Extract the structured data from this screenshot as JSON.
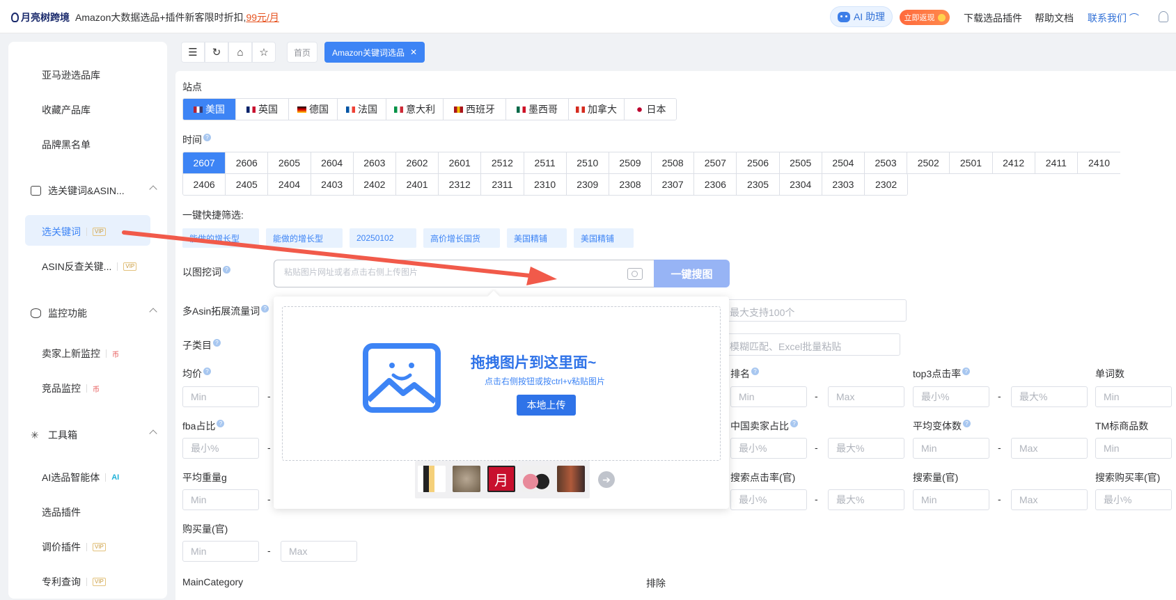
{
  "header": {
    "logo_text": "月亮树跨境",
    "promo_text": "Amazon大数据选品+插件新客限时折扣,",
    "promo_price": "99元/月",
    "ai_assistant": "AI 助理",
    "rebate": "立即返现",
    "nav": [
      "下载选品插件",
      "帮助文档",
      "联系我们"
    ]
  },
  "sidebar": {
    "items_top": [
      "亚马逊选品库",
      "收藏产品库",
      "品牌黑名单"
    ],
    "group_keywords": "选关键词&ASIN...",
    "keyword_items": [
      "选关键词",
      "ASIN反查关键..."
    ],
    "group_monitor": "监控功能",
    "monitor_items": [
      "卖家上新监控",
      "竞品监控"
    ],
    "group_tools": "工具箱",
    "tool_items": [
      "AI选品智能体",
      "选品插件",
      "调价插件",
      "专利查询"
    ],
    "vip": "VIP",
    "coin": "币",
    "ai": "AI"
  },
  "tabs": {
    "home": "首页",
    "active": "Amazon关键词选品"
  },
  "filters": {
    "site_label": "站点",
    "sites": [
      {
        "name": "美国",
        "colors": [
          "#b22234",
          "#fff",
          "#3c3b6e"
        ]
      },
      {
        "name": "英国",
        "colors": [
          "#012169",
          "#fff",
          "#c8102e"
        ]
      },
      {
        "name": "德国",
        "colors": [
          "#000",
          "#dd0000",
          "#ffce00"
        ]
      },
      {
        "name": "法国",
        "colors": [
          "#0055a4",
          "#fff",
          "#ef4135"
        ]
      },
      {
        "name": "意大利",
        "colors": [
          "#009246",
          "#fff",
          "#ce2b37"
        ]
      },
      {
        "name": "西班牙",
        "colors": [
          "#aa151b",
          "#f1bf00",
          "#aa151b"
        ]
      },
      {
        "name": "墨西哥",
        "colors": [
          "#006847",
          "#fff",
          "#ce1126"
        ]
      },
      {
        "name": "加拿大",
        "colors": [
          "#d52b1e",
          "#fff",
          "#d52b1e"
        ]
      },
      {
        "name": "日本",
        "colors": [
          "#fff",
          "#bc002d",
          "#fff"
        ]
      }
    ],
    "time_label": "时间",
    "time_row1": [
      "2607",
      "2606",
      "2605",
      "2604",
      "2603",
      "2602",
      "2601",
      "2512",
      "2511",
      "2510",
      "2509",
      "2508",
      "2507",
      "2506",
      "2505",
      "2504",
      "2503",
      "2502",
      "2501",
      "2412",
      "2411",
      "2410"
    ],
    "time_row2": [
      "2406",
      "2405",
      "2404",
      "2403",
      "2402",
      "2401",
      "2312",
      "2311",
      "2310",
      "2309",
      "2308",
      "2307",
      "2306",
      "2305",
      "2304",
      "2303",
      "2302"
    ],
    "quick_label": "一键快捷筛选:",
    "quick": [
      "能做的增长型",
      "能做的增长型",
      "20250102",
      "高价增长国货",
      "美国精铺",
      "美国精铺"
    ],
    "image_label": "以图挖词",
    "image_placeholder": "粘贴图片网址或者点击右侧上传图片",
    "image_button": "一键搜图",
    "multi_asin_label": "多Asin拓展流量词",
    "multi_asin_placeholder": "最大支持100个",
    "subcat_label": "子类目",
    "subcat_placeholder": "模糊匹配、Excel批量粘贴",
    "avg_price": "均价",
    "rank": "排名",
    "top3": "top3点击率",
    "word_count": "单词数",
    "fba": "fba占比",
    "cn_seller": "中国卖家占比",
    "avg_variant": "平均变体数",
    "tm_count": "TM标商品数",
    "avg_weight": "平均重量g",
    "search_ctr": "搜索点击率(官)",
    "search_vol": "搜索量(官)",
    "search_buy": "搜索购买率(官)",
    "purchase": "购买量(官)",
    "main_category": "MainCategory",
    "exclude": "排除",
    "min": "Min",
    "max": "Max",
    "min_pct": "最小%",
    "max_pct": "最大%",
    "dash": "-"
  },
  "popup": {
    "title": "拖拽图片到这里面~",
    "subtitle": "点击右侧按钮或按ctrl+v粘贴图片",
    "upload": "本地上传",
    "thumb_text": "月"
  }
}
